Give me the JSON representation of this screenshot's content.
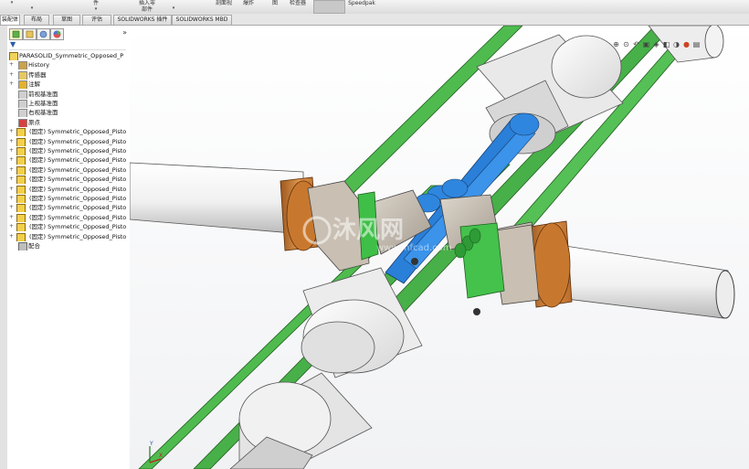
{
  "ribbon": {
    "items": [
      {
        "label": "装配体",
        "sub": ""
      },
      {
        "label": "件",
        "sub": ""
      },
      {
        "label": "插入零",
        "sub": "部件"
      },
      {
        "label": "剖面视",
        "sub": ""
      },
      {
        "label": "爆炸",
        "sub": ""
      },
      {
        "label": "图",
        "sub": ""
      },
      {
        "label": "检查器",
        "sub": ""
      },
      {
        "label": "Speedpak",
        "sub": ""
      }
    ]
  },
  "tabs": [
    "装配体",
    "布局",
    "草图",
    "评估",
    "SOLIDWORKS 插件",
    "SOLIDWORKS MBD"
  ],
  "tree": {
    "root": "PARASOLID_Symmetric_Opposed_P",
    "items": [
      "History",
      "传感器",
      "注解",
      "前视基准面",
      "上视基准面",
      "右视基准面",
      "原点",
      "(固定) Symmetric_Opposed_Pisto",
      "(固定) Symmetric_Opposed_Pisto",
      "(固定) Symmetric_Opposed_Pisto",
      "(固定) Symmetric_Opposed_Pisto",
      "(固定) Symmetric_Opposed_Pisto",
      "(固定) Symmetric_Opposed_Pisto",
      "(固定) Symmetric_Opposed_Pisto",
      "(固定) Symmetric_Opposed_Pisto",
      "(固定) Symmetric_Opposed_Pisto",
      "(固定) Symmetric_Opposed_Pisto",
      "(固定) Symmetric_Opposed_Pisto",
      "(固定) Symmetric_Opposed_Pisto",
      "配合"
    ]
  },
  "watermark": {
    "main": "沐风网",
    "url": "www.mfcad.com"
  },
  "triad": {
    "x": "X",
    "y": "Y"
  },
  "colors": {
    "frame_green": "#48b848",
    "piston_white": "#f2f2f2",
    "rod_blue": "#2a7fd8",
    "bearing_orange": "#c8782e",
    "block_tan": "#c9c0b4",
    "shaft_white": "#f4f4f4"
  }
}
